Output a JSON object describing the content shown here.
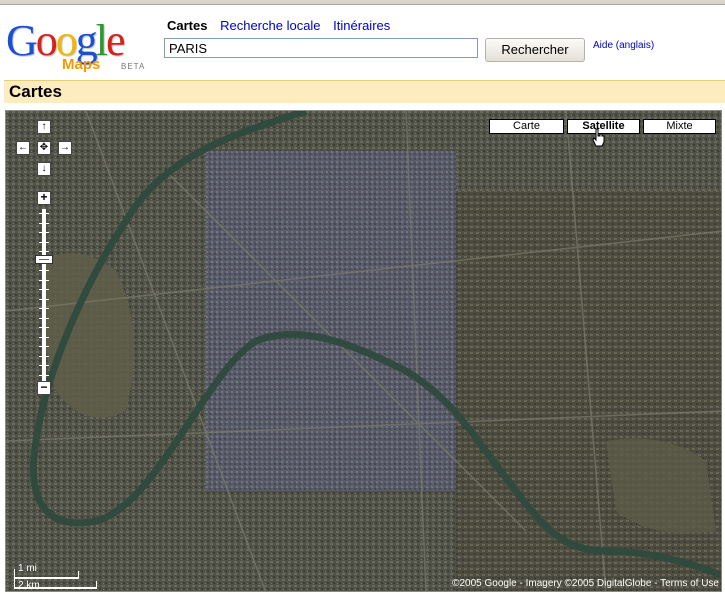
{
  "header": {
    "logo_letters": [
      "G",
      "o",
      "o",
      "g",
      "l",
      "e"
    ],
    "logo_colors": [
      "#1a4fd6",
      "#d8201c",
      "#f2b50a",
      "#1a4fd6",
      "#2a9a2c",
      "#d8201c"
    ],
    "maps_label": "Maps",
    "beta_label": "BETA",
    "tabs": [
      {
        "label": "Cartes",
        "active": true
      },
      {
        "label": "Recherche locale",
        "active": false
      },
      {
        "label": "Itinéraires",
        "active": false
      }
    ],
    "search_value": "PARIS",
    "search_button": "Rechercher",
    "help_link": "Aide (anglais)"
  },
  "section": {
    "title": "Cartes"
  },
  "map": {
    "map_types": [
      {
        "label": "Carte",
        "selected": false
      },
      {
        "label": "Satellite",
        "selected": true
      },
      {
        "label": "Mixte",
        "selected": false
      }
    ],
    "pan": {
      "up": "↑",
      "left": "←",
      "center": "✥",
      "right": "→",
      "down": "↓"
    },
    "zoom_in": "+",
    "zoom_out": "−",
    "zoom_level_fraction": 0.29,
    "scale_miles": "1 mi",
    "scale_km": "2 km",
    "copyright": "©2005 Google - Imagery ©2005 DigitalGlobe - Terms of Use"
  },
  "colors": {
    "river": "#2e4a3e",
    "accent_bar": "#fcecbe",
    "link": "#0000cc"
  }
}
